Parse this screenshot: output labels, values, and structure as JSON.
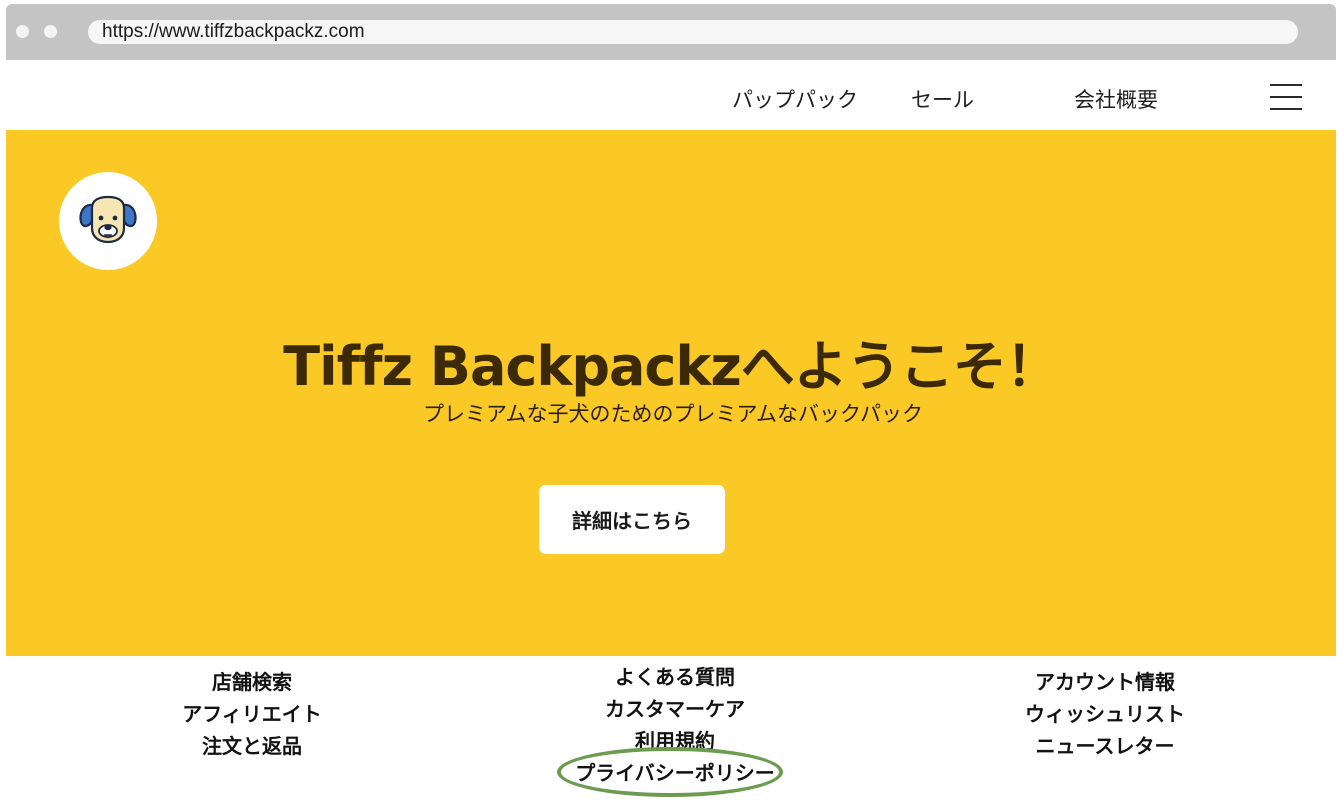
{
  "browser": {
    "url": "https://www.tiffzbackpackz.com"
  },
  "nav": {
    "items": [
      {
        "label": "パップパック"
      },
      {
        "label": "セール"
      },
      {
        "label": "会社概要"
      }
    ],
    "menu_icon": "hamburger-menu-icon"
  },
  "hero": {
    "logo_icon": "dog-face-icon",
    "title": "Tiffz Backpackzへようこそ！",
    "subtitle": "プレミアムな子犬のためのプレミアムなバックパック",
    "cta_label": "詳細はこちら",
    "background_color": "#fbc926"
  },
  "footer": {
    "columns": [
      {
        "links": [
          "店舗検索",
          "アフィリエイト",
          "注文と返品"
        ]
      },
      {
        "links": [
          "よくある質問",
          "カスタマーケア",
          "利用規約",
          "プライバシーポリシー"
        ]
      },
      {
        "links": [
          "アカウント情報",
          "ウィッシュリスト",
          "ニュースレター"
        ]
      }
    ],
    "highlight_color": "#6d9c50"
  }
}
